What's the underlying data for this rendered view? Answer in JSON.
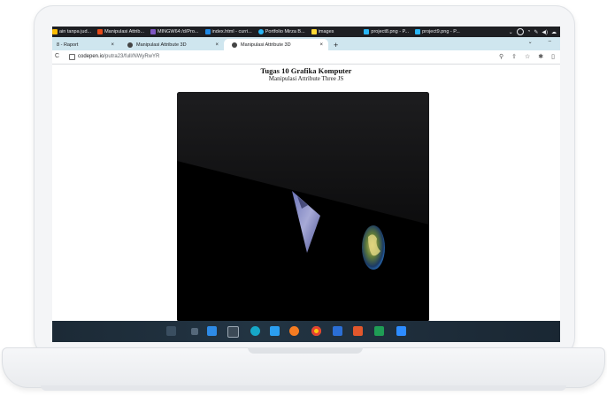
{
  "bookmarks": [
    {
      "label": "ain tanpa jud...",
      "color": "#fbbc04"
    },
    {
      "label": "Manipulasi Attrib...",
      "color": "#e64a19"
    },
    {
      "label": "MINGW64:/d/Pro...",
      "color": "#7e57c2"
    },
    {
      "label": "index.html - curri...",
      "color": "#1e88e5"
    },
    {
      "label": "Portfolio Mirza B...",
      "color": "#29b6f6"
    },
    {
      "label": "images",
      "color": "#fdd835"
    },
    {
      "label": "project8.png - P...",
      "color": "#29b6f6"
    },
    {
      "label": "project9.png - P...",
      "color": "#29b6f6"
    }
  ],
  "tabs": [
    {
      "label": "8 - Raport",
      "close": "×"
    },
    {
      "label": "Manipulasi Attribute 3D",
      "close": "×"
    },
    {
      "label": "Manipulasi Attribute 3D",
      "close": "×"
    }
  ],
  "new_tab": "+",
  "window_controls": [
    "⌄",
    "–"
  ],
  "address": {
    "host": "codepen.io",
    "path": "/putra23/full/NWyRwYR",
    "reload": "C"
  },
  "page": {
    "title": "Tugas 10 Grafika Komputer",
    "subtitle": "Manipulasi Attribute Three JS"
  },
  "taskbar_icons": [
    "widgets-icon",
    "search-icon",
    "start-icon",
    "task-view-icon",
    "terminal-icon",
    "arduino-icon",
    "vscode-icon",
    "firefox-icon",
    "chrome-icon",
    "word-icon",
    "powerpoint-icon",
    "excel-icon",
    "zoom-icon"
  ],
  "colors": {
    "bookmarks_bg": "#1e1f23",
    "tabs_bg": "#cfe6ef",
    "taskbar_bg": "#1f2f3d"
  }
}
